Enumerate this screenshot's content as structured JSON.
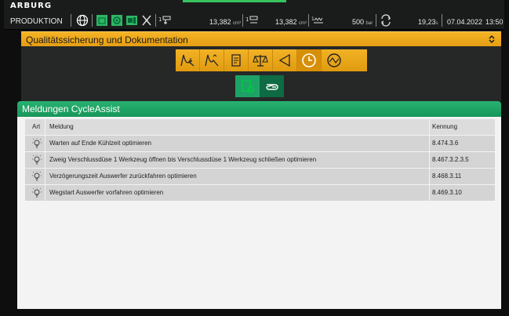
{
  "topbar": {
    "brand": "ARBURG",
    "mode": "PRODUKTION",
    "value1": "13,382",
    "value1_unit": "cm³",
    "value2": "13,382",
    "value2_unit": "cm³",
    "pressure": "500",
    "pressure_unit": "bar",
    "cycle_time": "19,23",
    "cycle_unit": "s",
    "date": "07.04.2022",
    "time": "13:50",
    "icons": [
      "globe-icon",
      "monitor-icon",
      "quality-icon",
      "machine-icon",
      "clamp-icon",
      "injection-icon"
    ]
  },
  "qs_panel": {
    "title": "Qualitätssicherung und Dokumentation",
    "strip_icons": [
      "curve-down-icon",
      "curve-peak-icon",
      "document-icon",
      "balance-icon",
      "horn-icon",
      "clock-icon",
      "cycle-gauge-icon"
    ],
    "active_strip_index": 5,
    "sub_icons": [
      "assist-doc-icon",
      "hand-pointer-icon"
    ],
    "active_sub_index": 1
  },
  "cycleassist": {
    "title": "Meldungen CycleAssist",
    "columns": {
      "art": "Art",
      "meldung": "Meldung",
      "kennung": "Kennung"
    },
    "rows": [
      {
        "icon": "lightbulb-icon",
        "meldung": "Warten auf Ende Kühlzeit optimieren",
        "kennung": "8.474.3.6"
      },
      {
        "icon": "lightbulb-icon",
        "meldung": "Zweig Verschlussdüse 1 Werkzeug öffnen bis Verschlussdüse 1 Werkzeug schließen optimieren",
        "kennung": "8.467.3.2.3.5"
      },
      {
        "icon": "lightbulb-icon",
        "meldung": "Verzögerungszeit Auswerfer zurückfahren optimieren",
        "kennung": "8.468.3.11"
      },
      {
        "icon": "lightbulb-icon",
        "meldung": "Wegstart Auswerfer vorfahren optimieren",
        "kennung": "8.469.3.10"
      }
    ]
  },
  "colors": {
    "orange": "#f2b226",
    "green": "#1ea366",
    "topbar_bg": "#1a1c1c"
  }
}
